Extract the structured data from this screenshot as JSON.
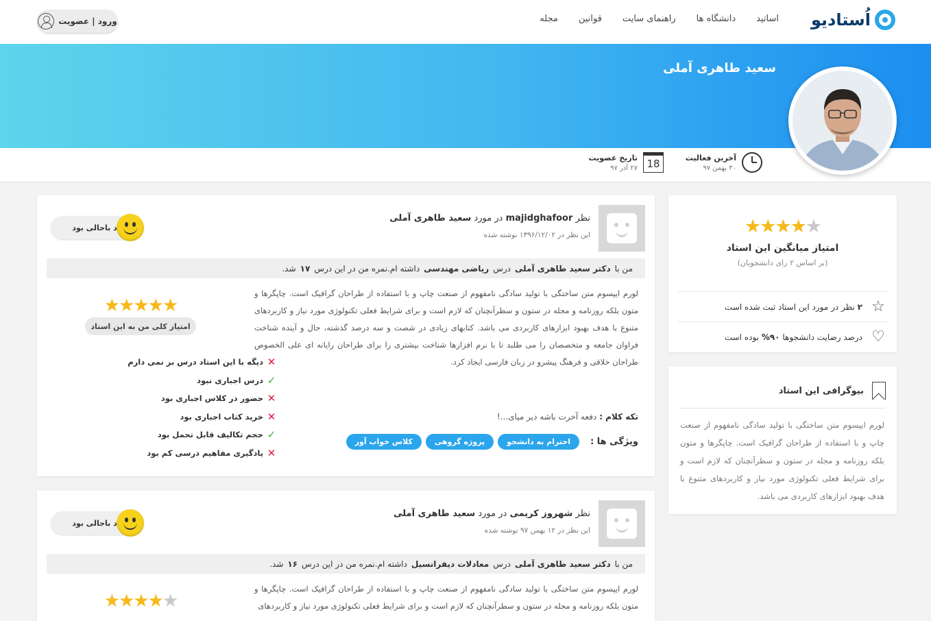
{
  "header": {
    "logo": "اُستادیو",
    "nav": [
      "اساتید",
      "دانشگاه ها",
      "راهنمای سایت",
      "قوانین",
      "مجله"
    ],
    "login": "ورود | عضویت"
  },
  "profile": {
    "name": "سعید طاهری آملی",
    "last_activity_label": "آخرین فعالیت",
    "last_activity_value": "۳۰ بهمن ۹۷",
    "join_label": "تاریخ عضویت",
    "join_value": "۲۷ آذر ۹۷",
    "calendar_day": "18"
  },
  "rating": {
    "stars": 4,
    "max": 5,
    "title": "امتیاز میانگین این استاد",
    "subtitle": "(بر اساس ۲ رای دانشجویان)",
    "stat1_num": "۲",
    "stat1_text": "نظر در مورد این استاد ثبت شده است",
    "stat2_pre": "درصد رضایت دانشجوها",
    "stat2_num": "۹۰%",
    "stat2_post": "بوده است"
  },
  "bio": {
    "title": "بیوگرافی این استاد",
    "text": "لورم ایپسوم متن ساختگی با تولید سادگی نامفهوم از صنعت چاپ و با استفاده از طراحان گرافیک است. چاپگرها و متون بلکه روزنامه و مجله در ستون و سطرآنچنان که لازم است و برای شرایط فعلی تکنولوژی مورد نیاز و کاربردهای متنوع با هدف بهبود ابزارهای کاربردی می باشد."
  },
  "reviews": [
    {
      "prefix": "نظر",
      "user": "majidghafoor",
      "middle": "در مورد",
      "teacher": "سعید طاهری آملی",
      "date": "این نظر در ۱۳۹۶/۱۲/۰۲ نوشته شده",
      "mood": "استاد باحالی بود",
      "course_pre": "من با",
      "course_teacher": "دکتر سعید طاهری آملی",
      "course_mid": "درس",
      "course_name": "ریاضی مهندسی",
      "course_post": "داشته ام.نمره من در این درس",
      "grade": "۱۷",
      "grade_post": "شد.",
      "body": "لورم ایپسوم متن ساختگی با تولید سادگی نامفهوم از صنعت چاپ و با استفاده از طراحان گرافیک است. چاپگرها و متون بلکه روزنامه و مجله در ستون و سطرآنچنان که لازم است و برای شرایط فعلی تکنولوژی مورد نیاز و کاربردهای متنوع با هدف بهبود ابزارهای کاربردی می باشد. کتابهای زیادی در شصت و سه درصد گذشته، حال و آینده شناخت فراوان جامعه و متخصصان را می طلبد تا با نرم افزارها شناخت بیشتری را برای طراحان رایانه ای علی الخصوص طراحان خلاقی و فرهنگ پیشرو در زبان فارسی ایجاد کرد.",
      "quote_label": "تکه کلام :",
      "quote": "دفعه آخرت باشه دیر میای...!",
      "features_label": "ویژگی ها :",
      "tags": [
        "احترام به دانشجو",
        "پروژه گروهی",
        "کلاس خواب آور"
      ],
      "stars": 5,
      "score_label": "امتیاز کلی من به این استاد",
      "checks": [
        {
          "text": "دیگه با این استاد درس بر نمی دارم",
          "ok": false
        },
        {
          "text": "درس اجباری نبود",
          "ok": true
        },
        {
          "text": "حضور در کلاس اجباری بود",
          "ok": false
        },
        {
          "text": "خرید کتاب اجباری بود",
          "ok": false
        },
        {
          "text": "حجم تکالیف قابل تحمل بود",
          "ok": true
        },
        {
          "text": "یادگیری مفاهیم درسی کم بود",
          "ok": false
        }
      ]
    },
    {
      "prefix": "نظر",
      "user": "شهروز کریمی",
      "middle": "در مورد",
      "teacher": "سعید طاهری آملی",
      "date": "این نظر در ۱۲ بهمن ۹۷ نوشته شده",
      "mood": "استاد باحالی بود",
      "course_pre": "من با",
      "course_teacher": "دکتر سعید طاهری آملی",
      "course_mid": "درس",
      "course_name": "معادلات دیفرانسیل",
      "course_post": "داشته ام.نمره من در این درس",
      "grade": "۱۶",
      "grade_post": "شد.",
      "body": "لورم ایپسوم متن ساختگی با تولید سادگی نامفهوم از صنعت چاپ و با استفاده از طراحان گرافیک است. چاپگرها و متون بلکه روزنامه و مجله در ستون و سطرآنچنان که لازم است و برای شرایط فعلی تکنولوژی مورد نیاز و کاربردهای",
      "stars": 4
    }
  ],
  "colors": {
    "accent": "#2ba5ec",
    "star": "#f6b91a",
    "check_ok": "#3cb43c",
    "check_no": "#e21a3a"
  }
}
